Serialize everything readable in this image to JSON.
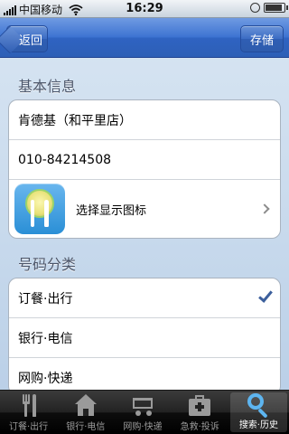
{
  "status_bar": {
    "carrier": "中国移动",
    "time": "16:29"
  },
  "nav": {
    "back_label": "返回",
    "save_label": "存储"
  },
  "basic_info": {
    "header": "基本信息",
    "name": "肯德基（和平里店）",
    "phone": "010-84214508",
    "icon_label": "选择显示图标"
  },
  "category": {
    "header": "号码分类",
    "items": [
      {
        "label": "订餐·出行",
        "selected": true
      },
      {
        "label": "银行·电信",
        "selected": false
      },
      {
        "label": "网购·快递",
        "selected": false
      }
    ]
  },
  "tabs": [
    {
      "label": "订餐·出行",
      "icon": "fork-knife-icon"
    },
    {
      "label": "银行·电信",
      "icon": "home-icon"
    },
    {
      "label": "网购·快递",
      "icon": "cart-icon"
    },
    {
      "label": "急救·投诉",
      "icon": "first-aid-kit-icon"
    },
    {
      "label": "搜索·历史",
      "icon": "search-icon",
      "active": true
    }
  ],
  "colors": {
    "nav_blue": "#3e74d2",
    "check_blue": "#3c5f9c",
    "active_tab_icon": "#5db5f0"
  }
}
